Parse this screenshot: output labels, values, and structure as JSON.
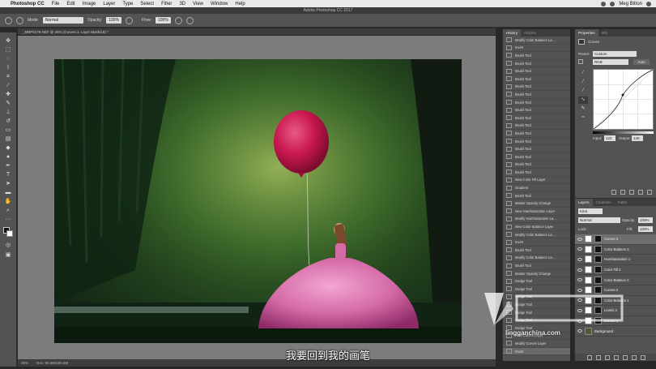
{
  "macbar": {
    "apple": "",
    "app": "Photoshop CC",
    "menus": [
      "File",
      "Edit",
      "Image",
      "Layer",
      "Type",
      "Select",
      "Filter",
      "3D",
      "View",
      "Window",
      "Help"
    ],
    "user": "Meg Bitton"
  },
  "window": {
    "title": "Adobe Photoshop CC 2017"
  },
  "options": {
    "mode_label": "Mode:",
    "mode_value": "Normal",
    "opacity_label": "Opacity:",
    "opacity_value": "100%",
    "flow_label": "Flow:",
    "flow_value": "100%"
  },
  "document": {
    "tab": "_MBP2179.NEF @ 25% (Curves 3, Layer Mask/16) *",
    "zoom": "25%",
    "doc_size": "Doc: 90.6M/255.6M"
  },
  "subtitle": "我要回到我的画笔",
  "history": {
    "tabs": [
      "History",
      "Actions"
    ],
    "items": [
      "Modify Color Balance La...",
      "Invert",
      "Brush Tool",
      "Brush Tool",
      "Brush Tool",
      "Brush Tool",
      "Brush Tool",
      "Brush Tool",
      "Brush Tool",
      "Brush Tool",
      "Brush Tool",
      "Brush Tool",
      "Brush Tool",
      "Brush Tool",
      "Brush Tool",
      "Brush Tool",
      "Brush Tool",
      "Brush Tool",
      "New Color Fill Layer",
      "Gradient",
      "Brush Tool",
      "Master Opacity Change",
      "New Hue/Saturation Layer",
      "Modify Hue/Saturation La...",
      "New Color Balance Layer",
      "Modify Color Balance La...",
      "Invert",
      "Brush Tool",
      "Modify Color Balance La...",
      "Brush Tool",
      "Master Opacity Change",
      "Dodge Tool",
      "Dodge Tool",
      "Dodge Tool",
      "Dodge Tool",
      "Dodge Tool",
      "Dodge Tool",
      "Dodge Tool",
      "New Curves Layer",
      "Modify Curves Layer",
      "Invert"
    ]
  },
  "properties": {
    "tabs": [
      "Properties",
      "Info"
    ],
    "heading": "Curves",
    "preset_label": "Preset:",
    "preset_value": "Custom",
    "channel_value": "RGB",
    "auto_label": "Auto",
    "input_label": "Input:",
    "input_value": "122",
    "output_label": "Output:",
    "output_value": "140"
  },
  "layers": {
    "tabs": [
      "Layers",
      "Channels",
      "Paths"
    ],
    "filter_value": "Kind",
    "blend_value": "Normal",
    "opacity_label": "Opacity:",
    "opacity_value": "100%",
    "lock_label": "Lock:",
    "fill_label": "Fill:",
    "fill_value": "100%",
    "items": [
      "Curves 3",
      "Color Balance 3",
      "Hue/Saturation 1",
      "Color Fill 2",
      "Color Balance 2",
      "Curves 2",
      "Color Balance 1",
      "Levels 2",
      "Curves 1",
      "Background"
    ]
  },
  "watermark": {
    "text": "lingganchina.com"
  },
  "colors": {
    "balloon": "#c8174f",
    "dress": "#d46aa6",
    "panel": "#535353"
  }
}
